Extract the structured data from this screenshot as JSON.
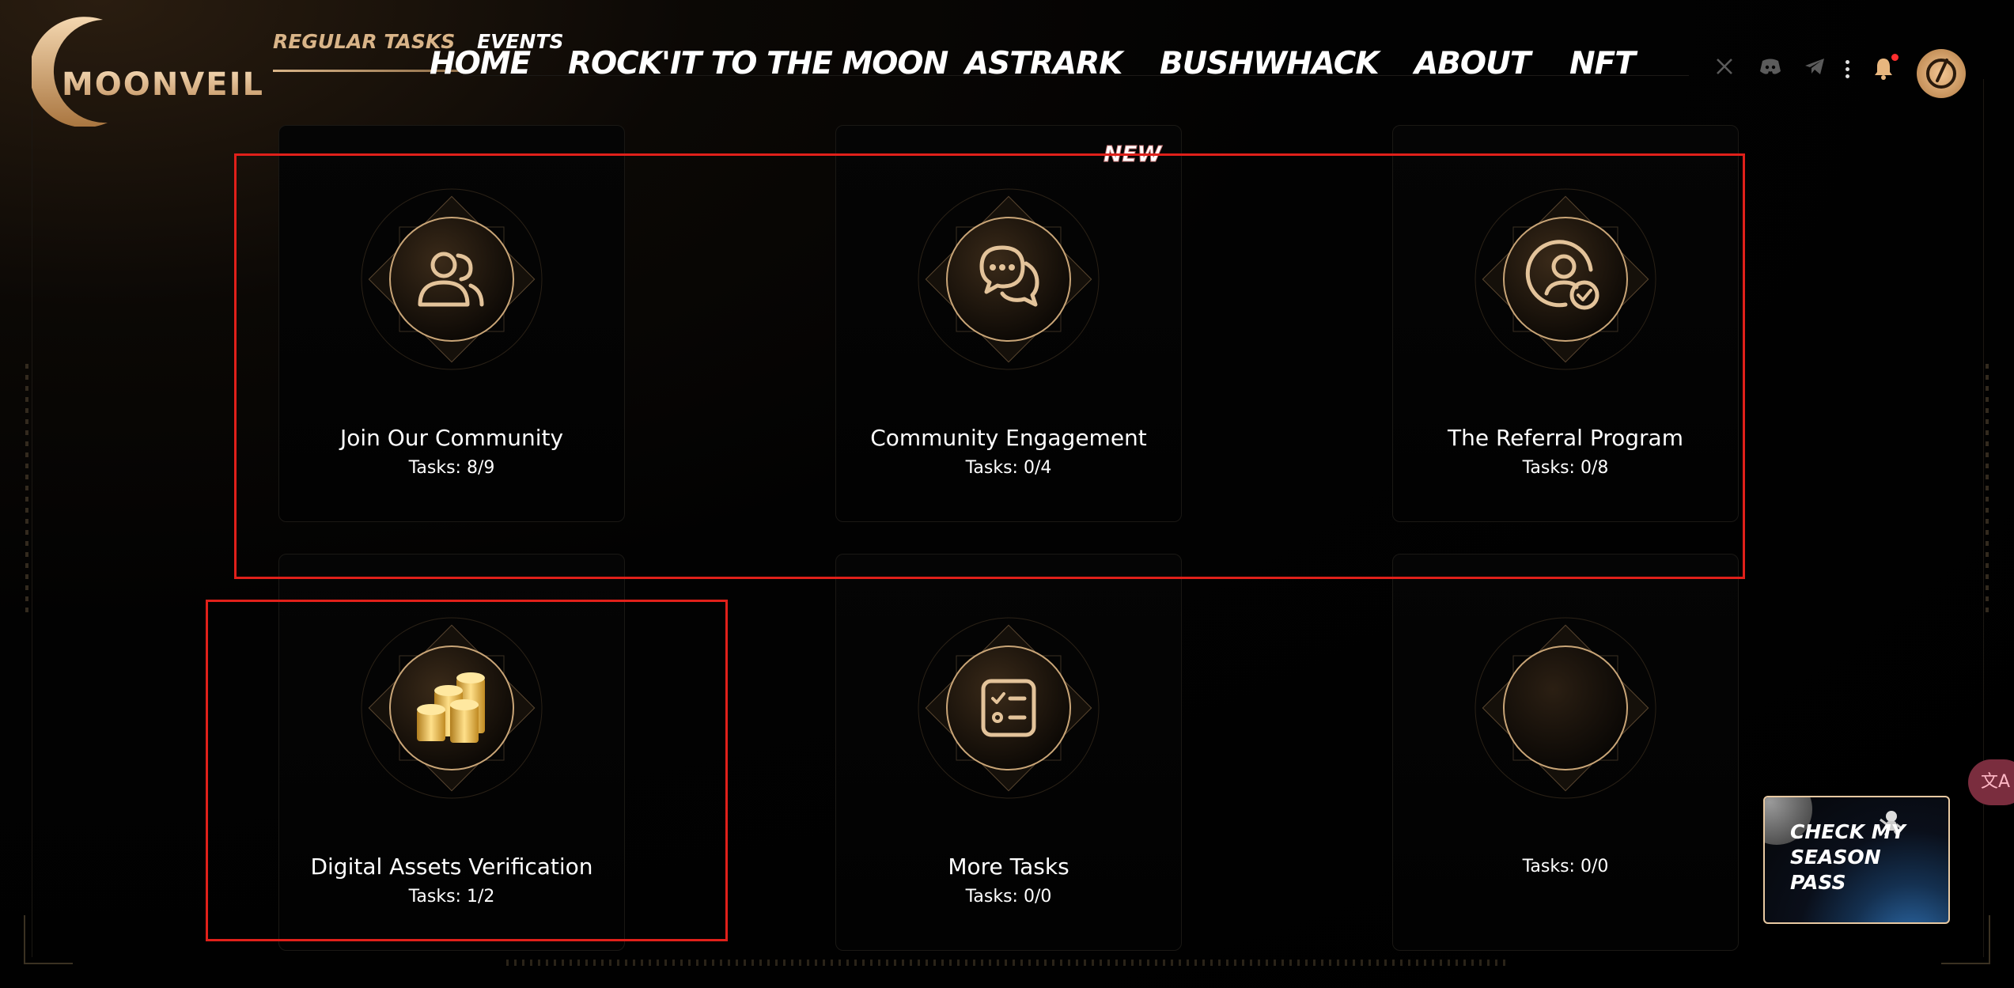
{
  "header": {
    "logo_text": "MOONVEIL",
    "tabs": [
      {
        "label": "REGULAR TASKS",
        "active": true
      },
      {
        "label": "EVENTS",
        "active": false
      }
    ],
    "nav": [
      "HOME",
      "ROCK'IT TO THE MOON",
      "ASTRARK",
      "BUSHWHACK",
      "ABOUT",
      "NFT"
    ],
    "social": [
      "x-icon",
      "discord-icon",
      "telegram-icon"
    ]
  },
  "cards": [
    {
      "title": "Join Our Community",
      "tasks": "Tasks: 8/9",
      "icon": "community-icon"
    },
    {
      "title": "Community Engagement",
      "tasks": "Tasks: 0/4",
      "icon": "chat-bubbles-icon",
      "badge": "NEW"
    },
    {
      "title": "The Referral Program",
      "tasks": "Tasks: 0/8",
      "icon": "user-check-icon"
    },
    {
      "title": "Digital Assets Verification",
      "tasks": "Tasks: 1/2",
      "icon": "gold-coins-icon"
    },
    {
      "title": "More Tasks",
      "tasks": "Tasks: 0/0",
      "icon": "checklist-icon"
    },
    {
      "title": "",
      "tasks": "Tasks: 0/0",
      "icon": "blank-emblem"
    }
  ],
  "season_pass": {
    "label": "CHECK MY SEASON PASS"
  },
  "translate": {
    "label": "文A"
  },
  "colors": {
    "accent": "#d9b488",
    "highlight": "#e0201a",
    "new_badge_outline": "#c07272"
  }
}
